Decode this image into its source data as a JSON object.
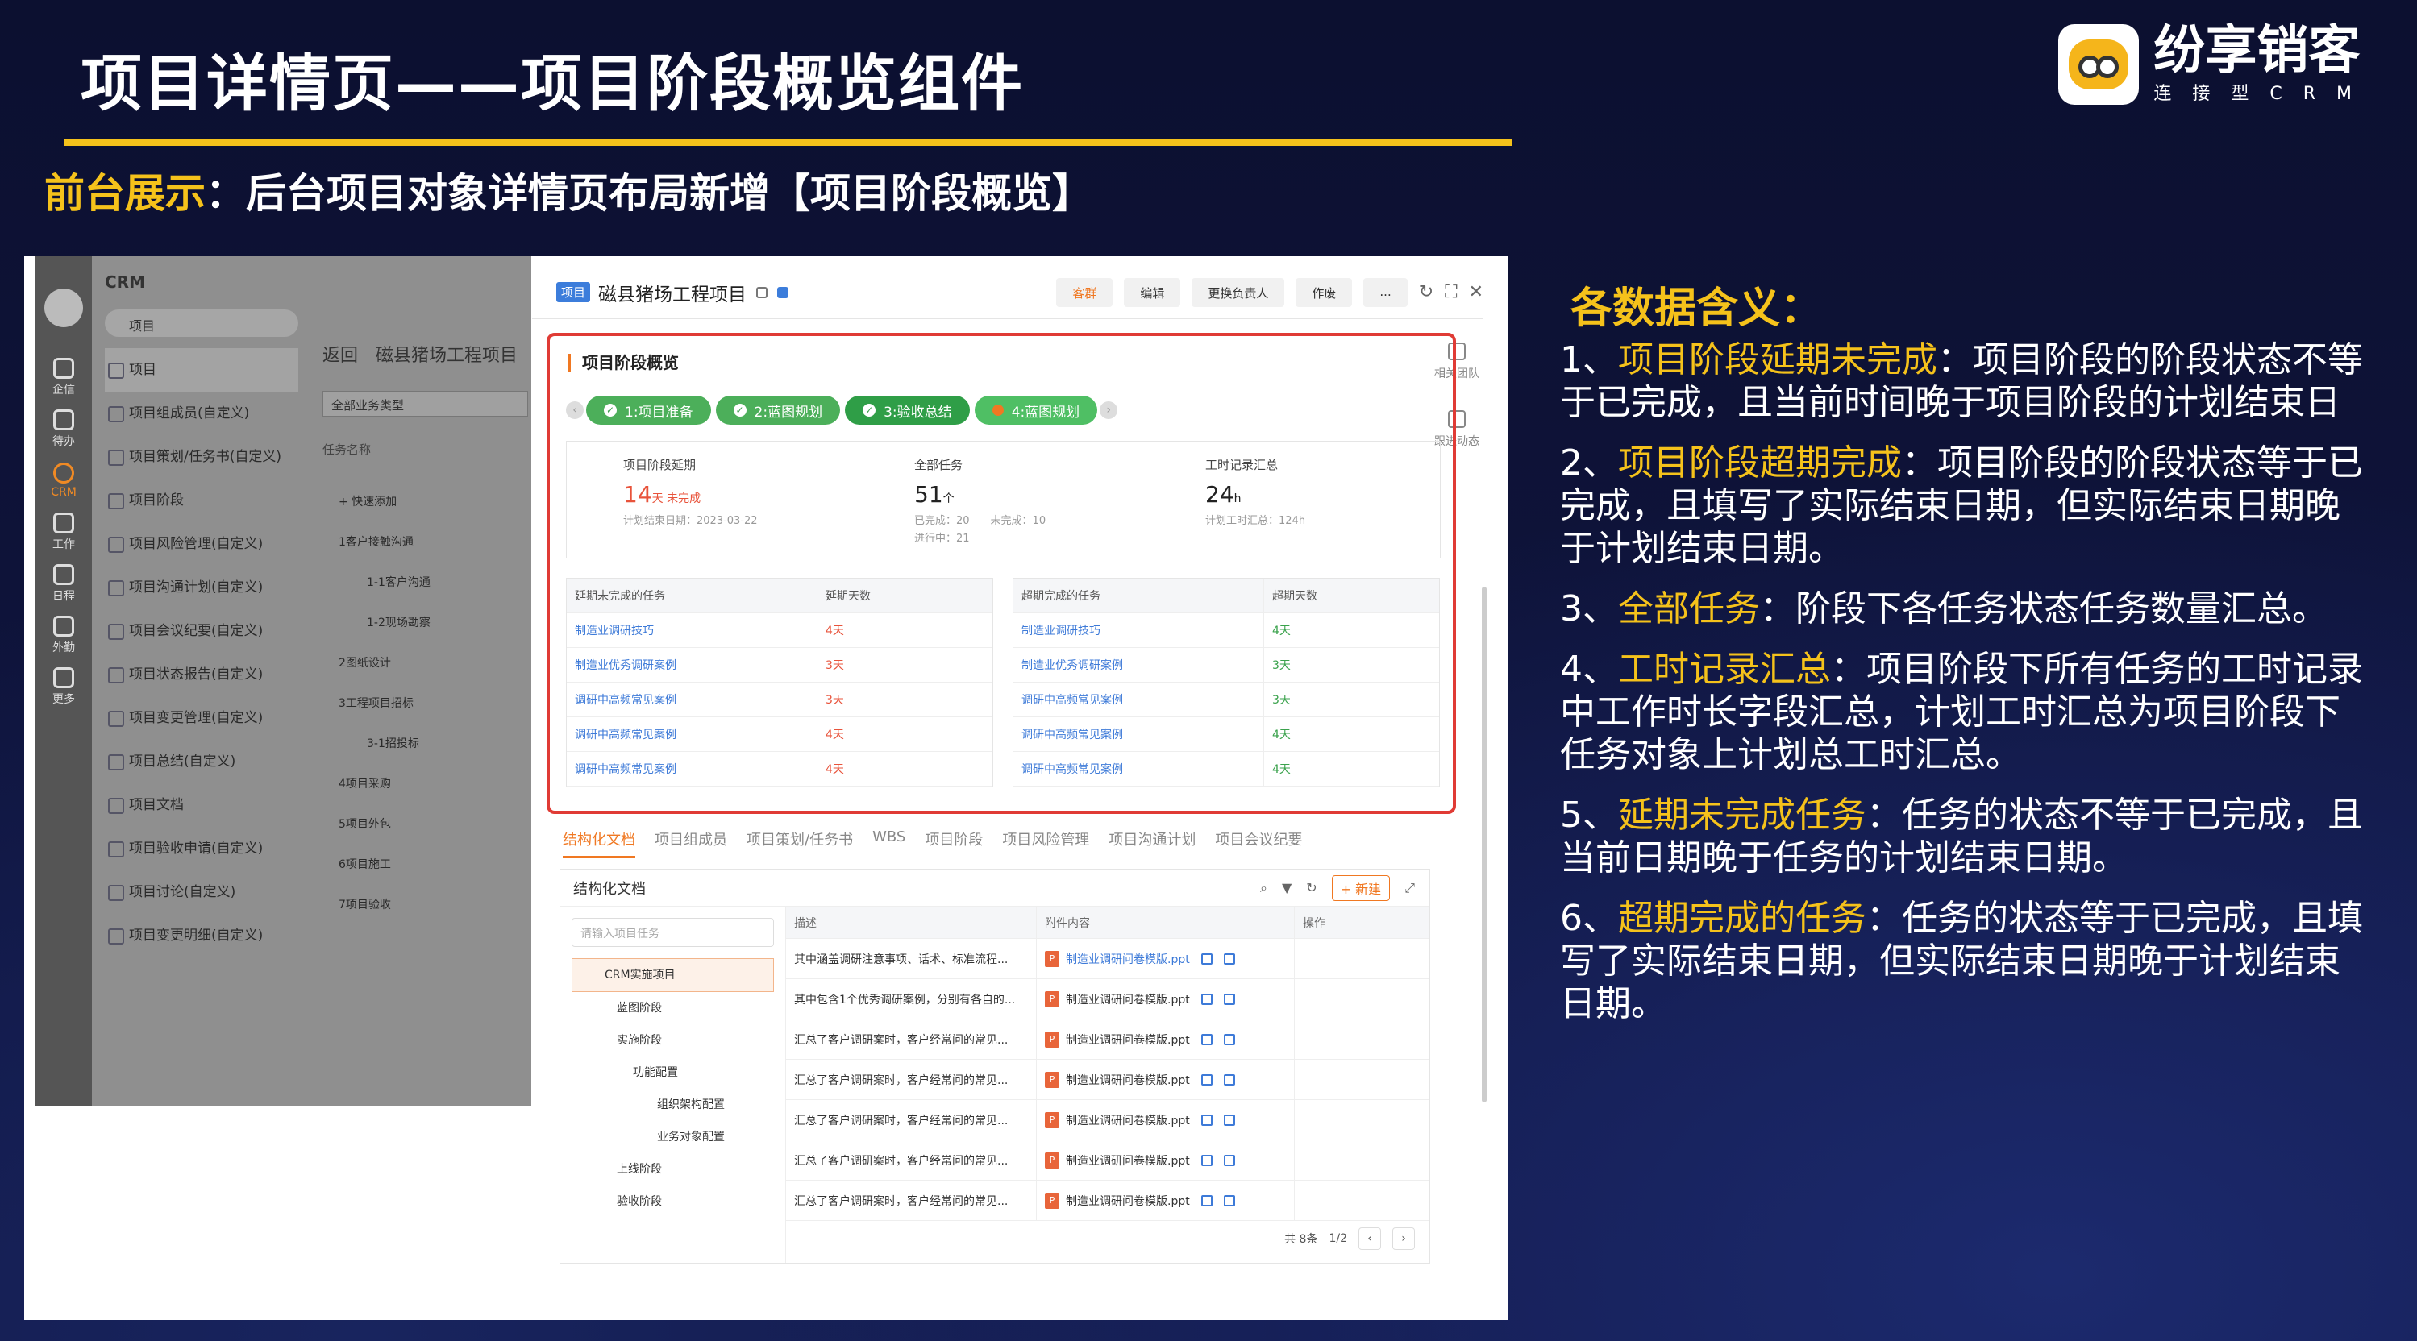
{
  "slide": {
    "title": "项目详情页——项目阶段概览组件",
    "subtitle_hl": "前台展示",
    "subtitle_rest": "：后台项目对象详情页布局新增【项目阶段概览】",
    "brand_name": "纷享销客",
    "brand_sub": "连接型CRM"
  },
  "meanings": {
    "heading": "各数据含义：",
    "items": [
      {
        "prefix": "1、",
        "kw": "项目阶段延期未完成",
        "text": "：项目阶段的阶段状态不等于已完成，且当前时间晚于项目阶段的计划结束日"
      },
      {
        "prefix": "2、",
        "kw": "项目阶段超期完成",
        "text": "：项目阶段的阶段状态等于已完成，且填写了实际结束日期，但实际结束日期晚于计划结束日期。"
      },
      {
        "prefix": "3、",
        "kw": "全部任务",
        "text": "：阶段下各任务状态任务数量汇总。"
      },
      {
        "prefix": "4、",
        "kw": "工时记录汇总",
        "text": "：项目阶段下所有任务的工时记录中工作时长字段汇总，计划工时汇总为项目阶段下任务对象上计划总工时汇总。"
      },
      {
        "prefix": "5、",
        "kw": "延期未完成任务",
        "text": "：任务的状态不等于已完成，且当前日期晚于任务的计划结束日期。"
      },
      {
        "prefix": "6、",
        "kw": "超期完成的任务",
        "text": "：任务的状态等于已完成，且填写了实际结束日期，但实际结束日期晚于计划结束日期。"
      }
    ]
  },
  "rail": [
    {
      "label": "企信"
    },
    {
      "label": "待办"
    },
    {
      "label": "CRM",
      "active": true
    },
    {
      "label": "工作"
    },
    {
      "label": "日程"
    },
    {
      "label": "外勤"
    },
    {
      "label": "更多"
    }
  ],
  "nav": {
    "crm": "CRM",
    "search": "项目",
    "items": [
      "项目",
      "项目组成员(自定义)",
      "项目策划/任务书(自定义)",
      "项目阶段",
      "项目风险管理(自定义)",
      "项目沟通计划(自定义)",
      "项目会议纪要(自定义)",
      "项目状态报告(自定义)",
      "项目变更管理(自定义)",
      "项目总结(自定义)",
      "项目文档",
      "项目验收申请(自定义)",
      "项目讨论(自定义)",
      "项目变更明细(自定义)"
    ]
  },
  "list": {
    "back": "返回",
    "title": "磁县猪场工程项目",
    "select": "全部业务类型",
    "header": "任务名称",
    "nodes": [
      {
        "label": "+ 快速添加",
        "lv": 1
      },
      {
        "label": "1客户接触沟通",
        "lv": 1
      },
      {
        "label": "1-1客户沟通",
        "lv": 2
      },
      {
        "label": "1-2现场勘察",
        "lv": 2
      },
      {
        "label": "2图纸设计",
        "lv": 1
      },
      {
        "label": "3工程项目招标",
        "lv": 1
      },
      {
        "label": "3-1招投标",
        "lv": 2
      },
      {
        "label": "4项目采购",
        "lv": 1
      },
      {
        "label": "5项目外包",
        "lv": 1
      },
      {
        "label": "6项目施工",
        "lv": 1
      },
      {
        "label": "7项目验收",
        "lv": 1
      }
    ]
  },
  "detail": {
    "tag": "项目",
    "name": "磁县猪场工程项目",
    "buttons": [
      "客群",
      "编辑",
      "更换负责人",
      "作废",
      "..."
    ],
    "side_tools": [
      "相关团队",
      "跟进动态"
    ]
  },
  "stage": {
    "title": "项目阶段概览",
    "steps": [
      {
        "label": "1:项目准备",
        "state": "done"
      },
      {
        "label": "2:蓝图规划",
        "state": "done"
      },
      {
        "label": "3:验收总结",
        "state": "cur"
      },
      {
        "label": "4:蓝图规划",
        "state": "next"
      }
    ],
    "stats": [
      {
        "label": "项目阶段延期",
        "value": "14",
        "unit": "天 未完成",
        "red": true,
        "sub": [
          "计划结束日期：2023-03-22"
        ]
      },
      {
        "label": "全部任务",
        "value": "51",
        "unit": "个",
        "red": false,
        "sub": [
          "已完成：20　　未完成：10",
          "进行中：21"
        ]
      },
      {
        "label": "工时记录汇总",
        "value": "24",
        "unit": "h",
        "red": false,
        "sub": [
          "计划工时汇总：124h"
        ]
      }
    ],
    "delayed": {
      "h1": "延期未完成的任务",
      "h2": "延期天数",
      "rows": [
        [
          "制造业调研技巧",
          "4天"
        ],
        [
          "制造业优秀调研案例",
          "3天"
        ],
        [
          "调研中高频常见案例",
          "3天"
        ],
        [
          "调研中高频常见案例",
          "4天"
        ],
        [
          "调研中高频常见案例",
          "4天"
        ]
      ]
    },
    "overdue": {
      "h1": "超期完成的任务",
      "h2": "超期天数",
      "rows": [
        [
          "制造业调研技巧",
          "4天"
        ],
        [
          "制造业优秀调研案例",
          "3天"
        ],
        [
          "调研中高频常见案例",
          "3天"
        ],
        [
          "调研中高频常见案例",
          "4天"
        ],
        [
          "调研中高频常见案例",
          "4天"
        ]
      ]
    }
  },
  "tabs": [
    "结构化文档",
    "项目组成员",
    "项目策划/任务书",
    "WBS",
    "项目阶段",
    "项目风险管理",
    "项目沟通计划",
    "项目会议纪要"
  ],
  "doc": {
    "title": "结构化文档",
    "new_btn": "+ 新建",
    "search_placeholder": "请输入项目任务",
    "tree": [
      {
        "label": "CRM实施项目",
        "lv": "sel"
      },
      {
        "label": "蓝图阶段",
        "lv": "l2"
      },
      {
        "label": "实施阶段",
        "lv": "l2"
      },
      {
        "label": "功能配置",
        "lv": "l3"
      },
      {
        "label": "组织架构配置",
        "lv": "l4"
      },
      {
        "label": "业务对象配置",
        "lv": "l4"
      },
      {
        "label": "上线阶段",
        "lv": "l2"
      },
      {
        "label": "验收阶段",
        "lv": "l2"
      }
    ],
    "cols": [
      "描述",
      "附件内容",
      "操作"
    ],
    "rows": [
      [
        "其中涵盖调研注意事项、话术、标准流程...",
        "制造业调研问卷模版.ppt"
      ],
      [
        "其中包含1个优秀调研案例，分别有各自的...",
        "制造业调研问卷模版.ppt"
      ],
      [
        "汇总了客户调研案时，客户经常问的常见...",
        "制造业调研问卷模版.ppt"
      ],
      [
        "汇总了客户调研案时，客户经常问的常见...",
        "制造业调研问卷模版.ppt"
      ],
      [
        "汇总了客户调研案时，客户经常问的常见...",
        "制造业调研问卷模版.ppt"
      ],
      [
        "汇总了客户调研案时，客户经常问的常见...",
        "制造业调研问卷模版.ppt"
      ],
      [
        "汇总了客户调研案时，客户经常问的常见...",
        "制造业调研问卷模版.ppt"
      ]
    ],
    "total": "共 8条",
    "page": "1/2"
  }
}
